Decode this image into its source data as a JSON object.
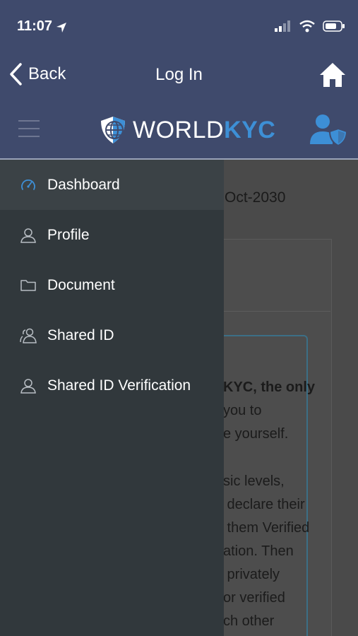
{
  "status": {
    "time": "11:07"
  },
  "nav": {
    "back_label": "Back",
    "title": "Log In"
  },
  "brand": {
    "name_part1": "WORLD",
    "name_part2": "KYC"
  },
  "menu": {
    "items": [
      {
        "label": "Dashboard",
        "icon": "dashboard-icon",
        "active": true
      },
      {
        "label": "Profile",
        "icon": "user-icon",
        "active": false
      },
      {
        "label": "Document",
        "icon": "folder-icon",
        "active": false
      },
      {
        "label": "Shared ID",
        "icon": "users-icon",
        "active": false
      },
      {
        "label": "Shared ID Verification",
        "icon": "user-icon",
        "active": false
      }
    ]
  },
  "background": {
    "date_fragment": "Oct-2030",
    "lines": [
      "KYC, the only",
      "you to",
      "e yourself.",
      "",
      "sic levels,",
      " declare their",
      " them Verified",
      "ation. Then",
      " privately",
      "or verified",
      "ch other"
    ]
  },
  "colors": {
    "header_bg": "#3f4a6c",
    "accent": "#3d8fd6",
    "drawer_bg": "#31383c",
    "drawer_active_bg": "#3b4246"
  }
}
